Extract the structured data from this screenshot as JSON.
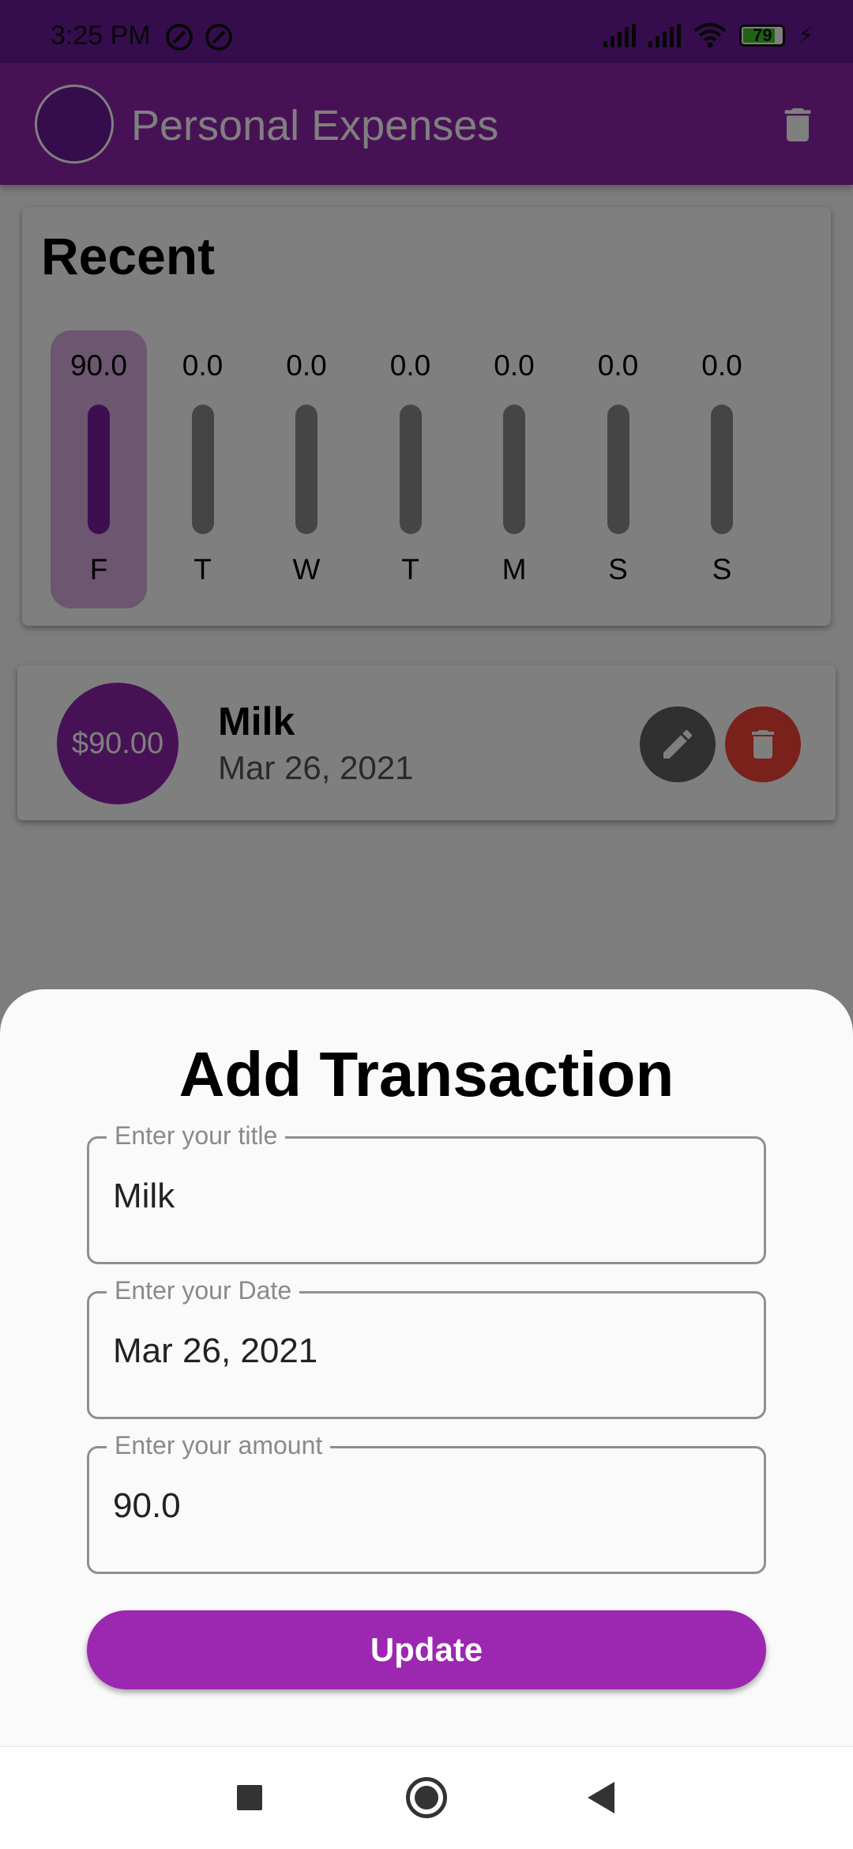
{
  "status_bar": {
    "time": "3:25 PM",
    "battery": "79"
  },
  "app_bar": {
    "title": "Personal Expenses",
    "trash_icon": "trash-icon"
  },
  "chart_section": {
    "title": "Recent"
  },
  "chart_data": {
    "type": "bar",
    "categories": [
      "F",
      "T",
      "W",
      "T",
      "M",
      "S",
      "S"
    ],
    "value_labels": [
      "90.0",
      "0.0",
      "0.0",
      "0.0",
      "0.0",
      "0.0",
      "0.0"
    ],
    "values": [
      90.0,
      0.0,
      0.0,
      0.0,
      0.0,
      0.0,
      0.0
    ],
    "selected_index": 0,
    "title": "",
    "xlabel": "",
    "ylabel": "",
    "grid": false,
    "colors": {
      "fill": "#7b1fa2",
      "track": "#8a8a8a"
    }
  },
  "transactions": [
    {
      "amount": "$90.00",
      "title": "Milk",
      "date": "Mar 26, 2021",
      "edit_icon": "pencil-icon",
      "delete_icon": "trash-icon"
    }
  ],
  "sheet": {
    "title": "Add Transaction",
    "fields": {
      "title": {
        "label": "Enter your title",
        "value": "Milk"
      },
      "date": {
        "label": "Enter your Date",
        "value": "Mar 26, 2021"
      },
      "amount": {
        "label": "Enter your amount",
        "value": "90.0"
      }
    },
    "submit_label": "Update"
  },
  "colors": {
    "primary": "#8e24aa",
    "primary_dark": "#6a1b9a",
    "button": "#9c27b0",
    "delete": "#f44336",
    "edit": "#616161"
  }
}
